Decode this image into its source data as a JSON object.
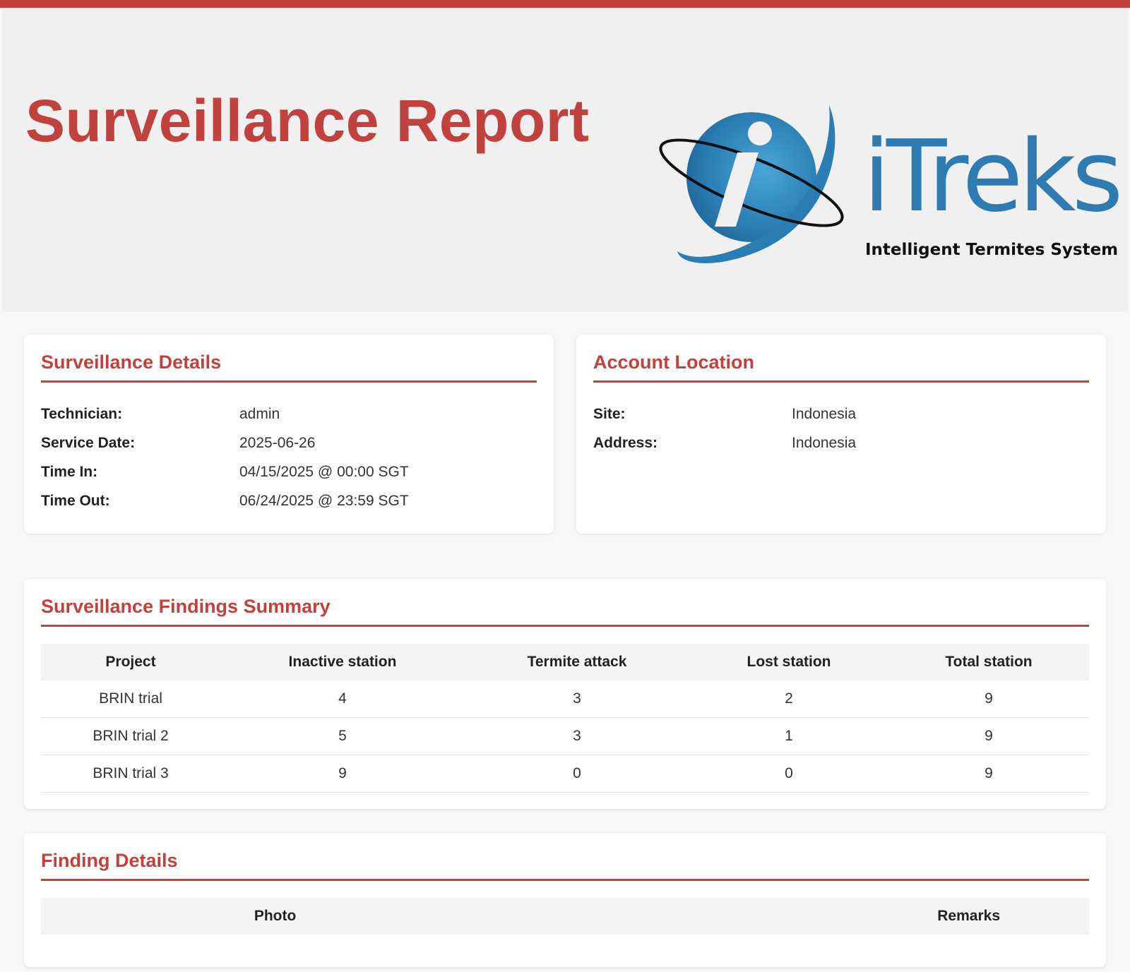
{
  "header": {
    "title": "Surveillance Report",
    "brand_name": "iTreks",
    "brand_tagline": "Intelligent Termites System"
  },
  "colors": {
    "accent": "#c0413d",
    "brand_blue": "#2d7bb0"
  },
  "surveillance_details": {
    "title": "Surveillance Details",
    "rows": [
      {
        "label": "Technician:",
        "value": "admin"
      },
      {
        "label": "Service Date:",
        "value": "2025-06-26"
      },
      {
        "label": "Time In:",
        "value": "04/15/2025 @ 00:00 SGT"
      },
      {
        "label": "Time Out:",
        "value": "06/24/2025 @ 23:59 SGT"
      }
    ]
  },
  "account_location": {
    "title": "Account Location",
    "rows": [
      {
        "label": "Site:",
        "value": "Indonesia"
      },
      {
        "label": "Address:",
        "value": "Indonesia"
      }
    ]
  },
  "findings_summary": {
    "title": "Surveillance Findings Summary",
    "columns": [
      "Project",
      "Inactive station",
      "Termite attack",
      "Lost station",
      "Total station"
    ],
    "rows": [
      [
        "BRIN trial",
        "4",
        "3",
        "2",
        "9"
      ],
      [
        "BRIN trial 2",
        "5",
        "3",
        "1",
        "9"
      ],
      [
        "BRIN trial 3",
        "9",
        "0",
        "0",
        "9"
      ]
    ]
  },
  "finding_details": {
    "title": "Finding Details",
    "columns": [
      "Photo",
      "Remarks"
    ]
  }
}
